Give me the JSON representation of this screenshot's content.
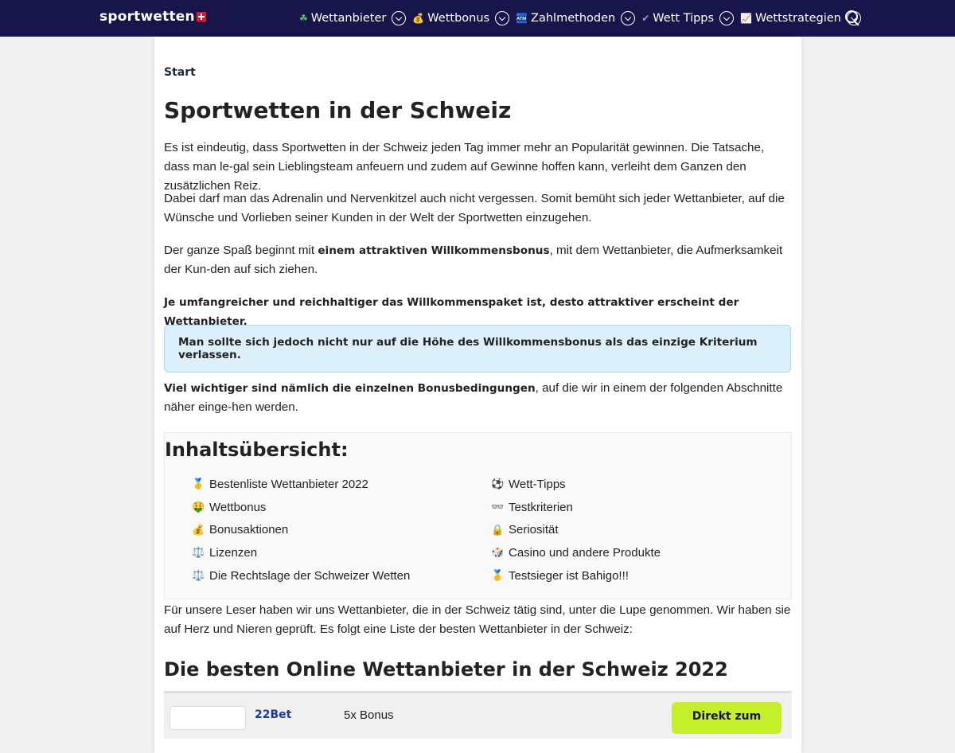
{
  "header": {
    "logo": "sportwetten",
    "nav": [
      {
        "icon": "☘",
        "label": "Wettanbieter"
      },
      {
        "icon": "💰",
        "label": "Wettbonus"
      },
      {
        "icon": "🏧",
        "label": "Zahlmethoden"
      },
      {
        "icon": "✔",
        "label": "Wett Tipps"
      },
      {
        "icon": "📈",
        "label": "Wettstrategien"
      }
    ],
    "search_icon": "search-icon",
    "colors": {
      "bar": "#17154a",
      "accent": "#c6ef2b"
    }
  },
  "breadcrumb": "Start",
  "title": "Sportwetten in der Schweiz",
  "intro": {
    "p1": "Es ist eindeutig, dass Sportwetten in der Schweiz jeden Tag immer mehr an Popularität gewinnen. Die Tatsache, dass man le-gal sein Lieblingsteam anfeuern und zudem auf Gewinne hoffen kann, verleiht dem Ganzen den zusätzlichen Reiz.",
    "p2": "Dabei darf man das Adrenalin und Nervenkitzel auch nicht vergessen. Somit bemüht sich jeder Wettanbieter, auf die Wünsche und Vorlieben seiner Kunden in der Welt der Sportwetten einzugehen.",
    "p3_pre": "Der ganze Spaß beginnt mit ",
    "p3_bold": "einem attraktiven Willkommensbonus",
    "p3_post": ", mit dem Wettanbieter, die Aufmerksamkeit der Kun-den auf sich ziehen.",
    "p4": "Je umfangreicher und reichhaltiger das Willkommenspaket ist, desto attraktiver erscheint der Wettanbieter.",
    "info": "Man sollte sich jedoch nicht nur auf die Höhe des Willkommensbonus als das einzige Kriterium verlassen.",
    "p5_bold": "Viel wichtiger sind nämlich die einzelnen Bonusbedingungen",
    "p5_post": ", auf die wir in einem der folgenden Abschnitte näher einge-hen werden."
  },
  "toc": {
    "title": "Inhaltsübersicht:",
    "left": [
      {
        "icon": "🥇",
        "label": "Bestenliste Wettanbieter 2022"
      },
      {
        "icon": "🤑",
        "label": "Wettbonus"
      },
      {
        "icon": "💰",
        "label": "Bonusaktionen"
      },
      {
        "icon": "⚖️",
        "label": "Lizenzen"
      },
      {
        "icon": "⚖️",
        "label": "Die Rechtslage der Schweizer Wetten"
      }
    ],
    "right": [
      {
        "icon": "⚽",
        "label": "Wett-Tipps"
      },
      {
        "icon": "👓",
        "label": "Testkriterien"
      },
      {
        "icon": "🔒",
        "label": "Seriosität"
      },
      {
        "icon": "🎲",
        "label": "Casino und andere Produkte"
      },
      {
        "icon": "🥇",
        "label": "Testsieger ist Bahigo!!!"
      }
    ]
  },
  "after_toc": "Für unsere Leser haben wir uns Wettanbieter, die in der Schweiz tätig sind, unter die Lupe genommen. Wir haben sie auf Herz und Nieren geprüft. Es folgt eine Liste der besten Wettanbieter in der Schweiz:",
  "section_title": "Die besten Online Wettanbieter in der Schweiz 2022",
  "offer": {
    "name": "22Bet",
    "bonus": "5x Bonus",
    "button": "Direkt zum"
  }
}
